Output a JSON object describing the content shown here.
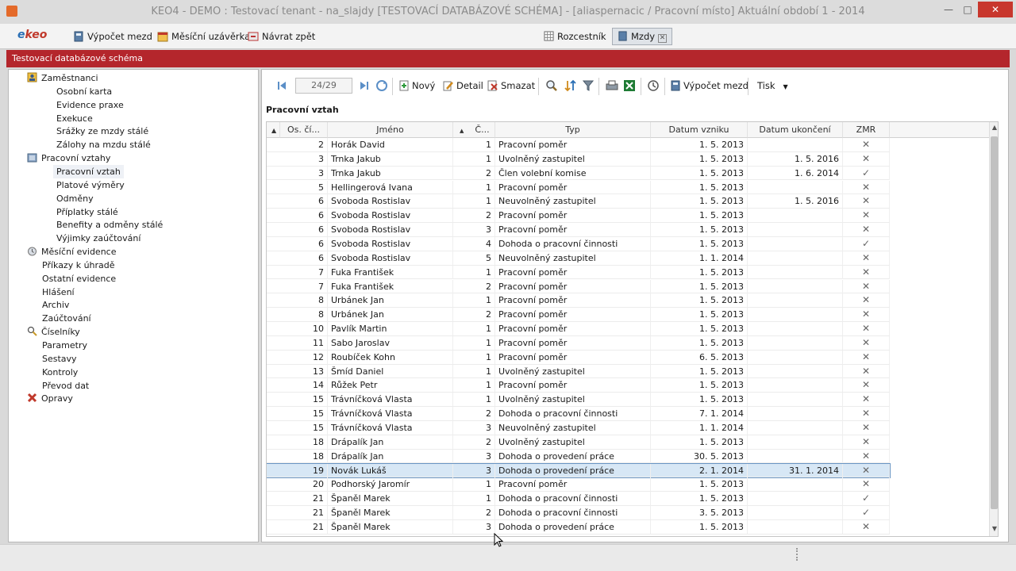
{
  "window": {
    "title": "KEO4 - DEMO : Testovací tenant - na_slajdy [TESTOVACÍ DATABÁZOVÉ SCHÉMA] - [aliaspernacic / Pracovní místo] Aktuální období 1 - 2014",
    "minimize": "—",
    "maximize": "□",
    "close": "✕"
  },
  "toolbar": {
    "logo_prefix": "e",
    "logo_text": "keo",
    "vypocet": "Výpočet mezd",
    "mesicni": "Měsíční uzávěrka",
    "navrat": "Návrat zpět",
    "tabs": [
      {
        "label": "Rozcestník",
        "active": false
      },
      {
        "label": "Mzdy",
        "active": true,
        "close": "✕"
      }
    ]
  },
  "header": {
    "schema": "Testovací databázové schéma"
  },
  "tree": [
    {
      "label": "Zaměstnanci",
      "level": 0,
      "icon": "employee-icon"
    },
    {
      "label": "Osobní karta",
      "level": 1
    },
    {
      "label": "Evidence praxe",
      "level": 1
    },
    {
      "label": "Exekuce",
      "level": 1
    },
    {
      "label": "Srážky ze mzdy stálé",
      "level": 1
    },
    {
      "label": "Zálohy na mzdu stálé",
      "level": 1
    },
    {
      "label": "Pracovní vztahy",
      "level": 0,
      "icon": "folder-icon"
    },
    {
      "label": "Pracovní vztah",
      "level": 1,
      "selected": true
    },
    {
      "label": "Platové výměry",
      "level": 1
    },
    {
      "label": "Odměny",
      "level": 1
    },
    {
      "label": "Příplatky stálé",
      "level": 1
    },
    {
      "label": "Benefity a odměny stálé",
      "level": 1
    },
    {
      "label": "Výjimky zaúčtování",
      "level": 1
    },
    {
      "label": "Měsíční evidence",
      "level": 0,
      "icon": "calendar-icon"
    },
    {
      "label": "Příkazy k úhradě",
      "level": 0
    },
    {
      "label": "Ostatní evidence",
      "level": 0
    },
    {
      "label": "Hlášení",
      "level": 0
    },
    {
      "label": "Archiv",
      "level": 0
    },
    {
      "label": "Zaúčtování",
      "level": 0
    },
    {
      "label": "Číselníky",
      "level": 0,
      "icon": "magnifier-icon"
    },
    {
      "label": "Parametry",
      "level": 0
    },
    {
      "label": "Sestavy",
      "level": 0
    },
    {
      "label": "Kontroly",
      "level": 0
    },
    {
      "label": "Převod dat",
      "level": 0
    },
    {
      "label": "Opravy",
      "level": 0,
      "icon": "tools-icon"
    }
  ],
  "gridbar": {
    "pager": "24/29",
    "novy": "Nový",
    "detail": "Detail",
    "smazat": "Smazat",
    "vypocet": "Výpočet mezd",
    "tisk": "Tisk",
    "section_title": "Pracovní vztah"
  },
  "grid": {
    "columns": [
      "Os. čí...",
      "Jméno",
      "Č...",
      "Typ",
      "Datum vzniku",
      "Datum ukončení",
      "ZMR"
    ],
    "sort_marker": "▲",
    "rows": [
      {
        "os": "2",
        "jmeno": "Horák David",
        "c": "1",
        "typ": "Pracovní poměr",
        "vznik": "1. 5. 2013",
        "konec": "",
        "zmr": "✕"
      },
      {
        "os": "3",
        "jmeno": "Trnka Jakub",
        "c": "1",
        "typ": "Uvolněný zastupitel",
        "vznik": "1. 5. 2013",
        "konec": "1. 5. 2016",
        "zmr": "✕"
      },
      {
        "os": "3",
        "jmeno": "Trnka Jakub",
        "c": "2",
        "typ": "Člen volební komise",
        "vznik": "1. 5. 2013",
        "konec": "1. 6. 2014",
        "zmr": "✓"
      },
      {
        "os": "5",
        "jmeno": "Hellingerová Ivana",
        "c": "1",
        "typ": "Pracovní poměr",
        "vznik": "1. 5. 2013",
        "konec": "",
        "zmr": "✕"
      },
      {
        "os": "6",
        "jmeno": "Svoboda Rostislav",
        "c": "1",
        "typ": "Neuvolněný zastupitel",
        "vznik": "1. 5. 2013",
        "konec": "1. 5. 2016",
        "zmr": "✕"
      },
      {
        "os": "6",
        "jmeno": "Svoboda Rostislav",
        "c": "2",
        "typ": "Pracovní poměr",
        "vznik": "1. 5. 2013",
        "konec": "",
        "zmr": "✕"
      },
      {
        "os": "6",
        "jmeno": "Svoboda Rostislav",
        "c": "3",
        "typ": "Pracovní poměr",
        "vznik": "1. 5. 2013",
        "konec": "",
        "zmr": "✕"
      },
      {
        "os": "6",
        "jmeno": "Svoboda Rostislav",
        "c": "4",
        "typ": "Dohoda o pracovní činnosti",
        "vznik": "1. 5. 2013",
        "konec": "",
        "zmr": "✓"
      },
      {
        "os": "6",
        "jmeno": "Svoboda Rostislav",
        "c": "5",
        "typ": "Neuvolněný zastupitel",
        "vznik": "1. 1. 2014",
        "konec": "",
        "zmr": "✕"
      },
      {
        "os": "7",
        "jmeno": "Fuka František",
        "c": "1",
        "typ": "Pracovní poměr",
        "vznik": "1. 5. 2013",
        "konec": "",
        "zmr": "✕"
      },
      {
        "os": "7",
        "jmeno": "Fuka František",
        "c": "2",
        "typ": "Pracovní poměr",
        "vznik": "1. 5. 2013",
        "konec": "",
        "zmr": "✕"
      },
      {
        "os": "8",
        "jmeno": "Urbánek Jan",
        "c": "1",
        "typ": "Pracovní poměr",
        "vznik": "1. 5. 2013",
        "konec": "",
        "zmr": "✕"
      },
      {
        "os": "8",
        "jmeno": "Urbánek Jan",
        "c": "2",
        "typ": "Pracovní poměr",
        "vznik": "1. 5. 2013",
        "konec": "",
        "zmr": "✕"
      },
      {
        "os": "10",
        "jmeno": "Pavlík Martin",
        "c": "1",
        "typ": "Pracovní poměr",
        "vznik": "1. 5. 2013",
        "konec": "",
        "zmr": "✕"
      },
      {
        "os": "11",
        "jmeno": "Sabo Jaroslav",
        "c": "1",
        "typ": "Pracovní poměr",
        "vznik": "1. 5. 2013",
        "konec": "",
        "zmr": "✕"
      },
      {
        "os": "12",
        "jmeno": "Roubíček Kohn",
        "c": "1",
        "typ": "Pracovní poměr",
        "vznik": "6. 5. 2013",
        "konec": "",
        "zmr": "✕"
      },
      {
        "os": "13",
        "jmeno": "Šmíd Daniel",
        "c": "1",
        "typ": "Uvolněný zastupitel",
        "vznik": "1. 5. 2013",
        "konec": "",
        "zmr": "✕"
      },
      {
        "os": "14",
        "jmeno": "Růžek Petr",
        "c": "1",
        "typ": "Pracovní poměr",
        "vznik": "1. 5. 2013",
        "konec": "",
        "zmr": "✕"
      },
      {
        "os": "15",
        "jmeno": "Trávníčková Vlasta",
        "c": "1",
        "typ": "Uvolněný zastupitel",
        "vznik": "1. 5. 2013",
        "konec": "",
        "zmr": "✕"
      },
      {
        "os": "15",
        "jmeno": "Trávníčková Vlasta",
        "c": "2",
        "typ": "Dohoda o pracovní činnosti",
        "vznik": "7. 1. 2014",
        "konec": "",
        "zmr": "✕"
      },
      {
        "os": "15",
        "jmeno": "Trávníčková Vlasta",
        "c": "3",
        "typ": "Neuvolněný zastupitel",
        "vznik": "1. 1. 2014",
        "konec": "",
        "zmr": "✕"
      },
      {
        "os": "18",
        "jmeno": "Drápalík Jan",
        "c": "2",
        "typ": "Uvolněný zastupitel",
        "vznik": "1. 5. 2013",
        "konec": "",
        "zmr": "✕"
      },
      {
        "os": "18",
        "jmeno": "Drápalík Jan",
        "c": "3",
        "typ": "Dohoda o provedení práce",
        "vznik": "30. 5. 2013",
        "konec": "",
        "zmr": "✕"
      },
      {
        "os": "19",
        "jmeno": "Novák Lukáš",
        "c": "3",
        "typ": "Dohoda o provedení práce",
        "vznik": "2. 1. 2014",
        "konec": "31. 1. 2014",
        "zmr": "✕",
        "selected": true
      },
      {
        "os": "20",
        "jmeno": "Podhorský Jaromír",
        "c": "1",
        "typ": "Pracovní poměr",
        "vznik": "1. 5. 2013",
        "konec": "",
        "zmr": "✕"
      },
      {
        "os": "21",
        "jmeno": "Španěl Marek",
        "c": "1",
        "typ": "Dohoda o pracovní činnosti",
        "vznik": "1. 5. 2013",
        "konec": "",
        "zmr": "✓"
      },
      {
        "os": "21",
        "jmeno": "Španěl Marek",
        "c": "2",
        "typ": "Dohoda o pracovní činnosti",
        "vznik": "3. 5. 2013",
        "konec": "",
        "zmr": "✓"
      },
      {
        "os": "21",
        "jmeno": "Španěl Marek",
        "c": "3",
        "typ": "Dohoda o provedení práce",
        "vznik": "1. 5. 2013",
        "konec": "",
        "zmr": "✕"
      }
    ]
  },
  "colors": {
    "accent_red": "#b4262c",
    "selection": "#d7e7f5",
    "excel_green": "#1e7b34"
  }
}
